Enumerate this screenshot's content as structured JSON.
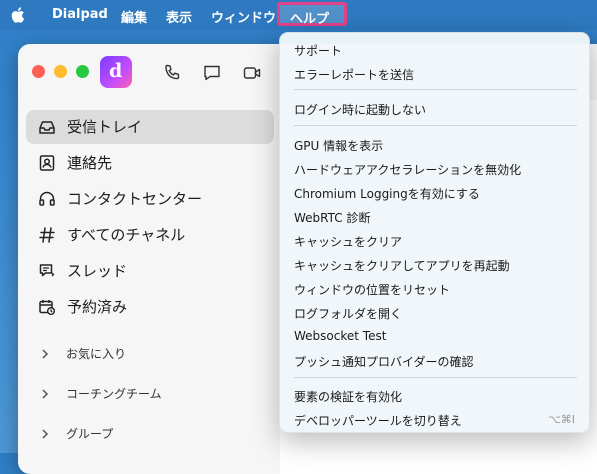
{
  "menubar": {
    "app_name": "Dialpad",
    "items": [
      "編集",
      "表示",
      "ウィンドウ"
    ],
    "help": "ヘルプ"
  },
  "sidebar": {
    "items": [
      {
        "label": "受信トレイ",
        "icon": "inbox-icon",
        "selected": true
      },
      {
        "label": "連絡先",
        "icon": "contacts-icon"
      },
      {
        "label": "コンタクトセンター",
        "icon": "headset-icon"
      },
      {
        "label": "すべてのチャネル",
        "icon": "hash-icon"
      },
      {
        "label": "スレッド",
        "icon": "thread-icon"
      },
      {
        "label": "予約済み",
        "icon": "scheduled-icon"
      }
    ],
    "groups": [
      "お気に入り",
      "コーチングチーム",
      "グループ"
    ]
  },
  "help_menu": {
    "sections": [
      [
        "サポート",
        "エラーレポートを送信"
      ],
      [
        "ログイン時に起動しない"
      ],
      [
        "GPU 情報を表示",
        "ハードウェアアクセラレーションを無効化",
        "Chromium Loggingを有効にする",
        "WebRTC 診断",
        "キャッシュをクリア",
        "キャッシュをクリアしてアプリを再起動",
        "ウィンドウの位置をリセット",
        "ログフォルダを開く",
        "Websocket Test",
        "プッシュ通知プロバイダーの確認"
      ],
      [
        "要素の検証を有効化",
        "デベロッパーツールを切り替え"
      ]
    ],
    "devtools_shortcut": "⌥⌘I"
  },
  "colors": {
    "highlight_border": "#e0428a",
    "menubar_bg": "#2e79c0",
    "close": "#fe5f57",
    "minimize": "#febc2e",
    "zoom": "#28c840"
  }
}
